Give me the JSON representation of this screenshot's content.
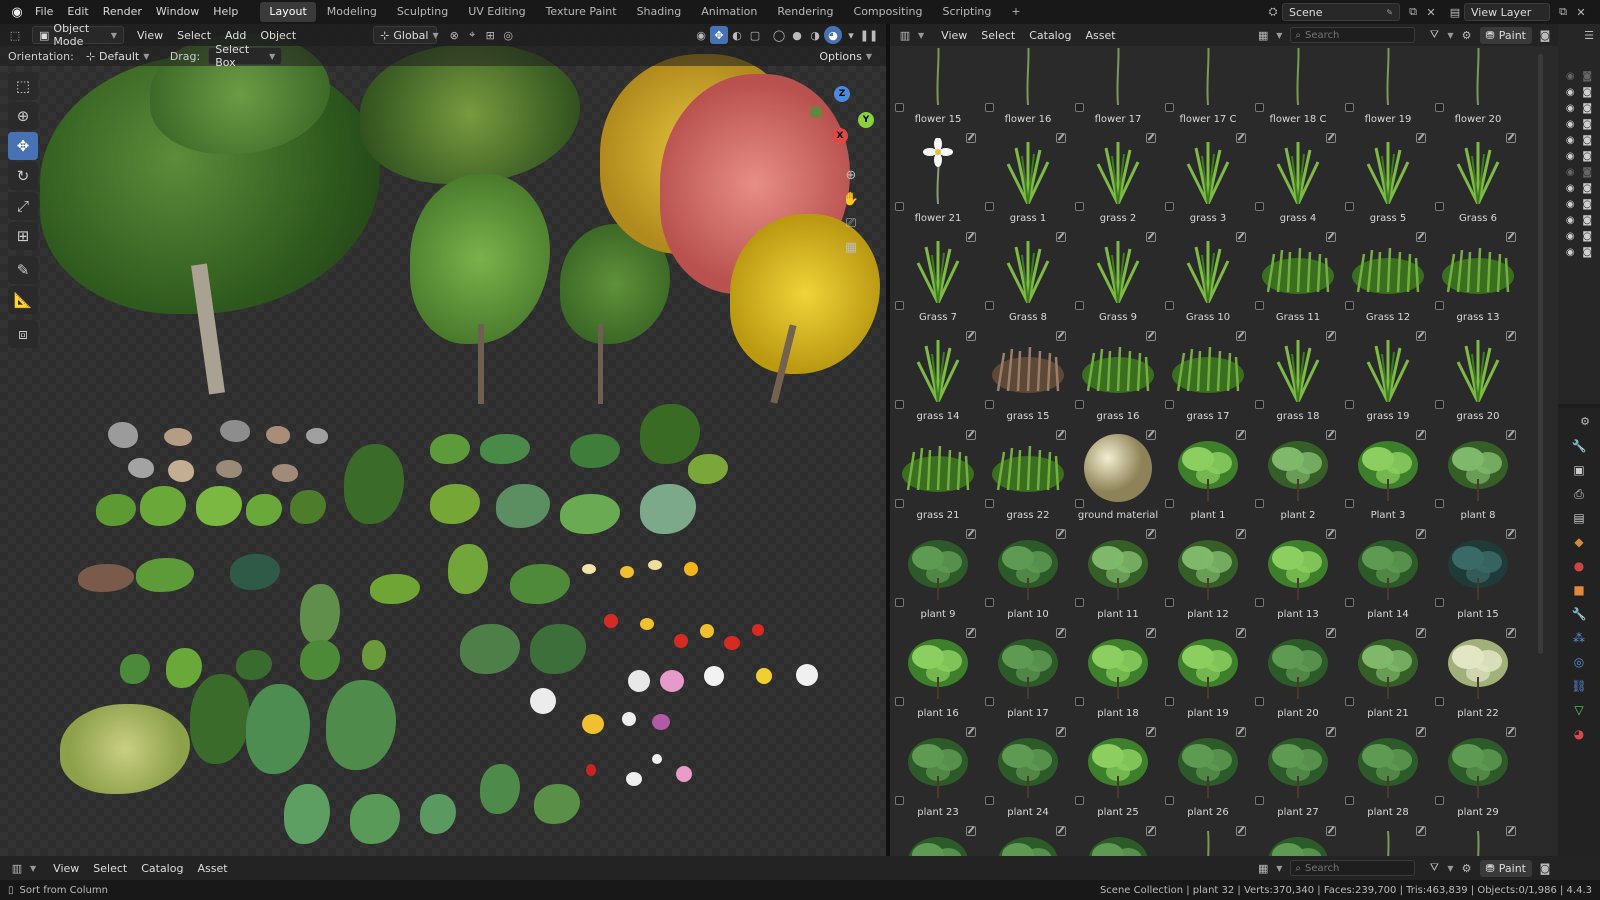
{
  "topbar": {
    "menus": [
      "File",
      "Edit",
      "Render",
      "Window",
      "Help"
    ],
    "workspaces": [
      "Layout",
      "Modeling",
      "Sculpting",
      "UV Editing",
      "Texture Paint",
      "Shading",
      "Animation",
      "Rendering",
      "Compositing",
      "Scripting"
    ],
    "active_workspace": "Layout",
    "add_tab": "+",
    "scene": "Scene",
    "view_layer": "View Layer"
  },
  "viewport": {
    "mode": "Object Mode",
    "menus": [
      "View",
      "Select",
      "Add",
      "Object"
    ],
    "transform": "Global",
    "orientation_label": "Orientation:",
    "orientation": "Default",
    "drag_label": "Drag:",
    "drag": "Select Box",
    "options": "Options",
    "gizmo": {
      "x": "X",
      "y": "Y",
      "z": "Z"
    }
  },
  "asset_browser": {
    "menus": [
      "View",
      "Select",
      "Catalog",
      "Asset"
    ],
    "search_placeholder": "Search",
    "paint": "Paint",
    "assets": [
      {
        "name": "flower 15",
        "kind": "stem"
      },
      {
        "name": "flower 16",
        "kind": "stem"
      },
      {
        "name": "flower 17",
        "kind": "stem"
      },
      {
        "name": "flower 17 C",
        "kind": "stem"
      },
      {
        "name": "flower 18 C",
        "kind": "stem"
      },
      {
        "name": "flower 19",
        "kind": "stem"
      },
      {
        "name": "flower 20",
        "kind": "stem"
      },
      {
        "name": "flower 21",
        "kind": "flower"
      },
      {
        "name": "grass 1",
        "kind": "grass"
      },
      {
        "name": "grass 2",
        "kind": "grass"
      },
      {
        "name": "grass 3",
        "kind": "grass"
      },
      {
        "name": "grass 4",
        "kind": "grass"
      },
      {
        "name": "grass 5",
        "kind": "grass"
      },
      {
        "name": "Grass 6",
        "kind": "grass"
      },
      {
        "name": "Grass 7",
        "kind": "grass"
      },
      {
        "name": "Grass 8",
        "kind": "grass"
      },
      {
        "name": "Grass 9",
        "kind": "grass"
      },
      {
        "name": "Grass 10",
        "kind": "grass"
      },
      {
        "name": "Grass 11",
        "kind": "tuft"
      },
      {
        "name": "Grass 12",
        "kind": "tuft"
      },
      {
        "name": "grass 13",
        "kind": "tuft"
      },
      {
        "name": "grass 14",
        "kind": "grass"
      },
      {
        "name": "grass 15",
        "kind": "dry"
      },
      {
        "name": "grass 16",
        "kind": "tuft"
      },
      {
        "name": "grass 17",
        "kind": "tuft"
      },
      {
        "name": "grass 18",
        "kind": "grass"
      },
      {
        "name": "grass 19",
        "kind": "grass"
      },
      {
        "name": "grass 20",
        "kind": "grass"
      },
      {
        "name": "grass 21",
        "kind": "tuft"
      },
      {
        "name": "grass 22",
        "kind": "tuft"
      },
      {
        "name": "ground material",
        "kind": "sphere"
      },
      {
        "name": "plant 1",
        "kind": "plant"
      },
      {
        "name": "plant 2",
        "kind": "fern"
      },
      {
        "name": "Plant 3",
        "kind": "plant"
      },
      {
        "name": "plant 8",
        "kind": "fern"
      },
      {
        "name": "plant 9",
        "kind": "bush"
      },
      {
        "name": "plant 10",
        "kind": "bush"
      },
      {
        "name": "plant 11",
        "kind": "fern"
      },
      {
        "name": "plant 12",
        "kind": "fern"
      },
      {
        "name": "plant 13",
        "kind": "plant"
      },
      {
        "name": "plant 14",
        "kind": "bush"
      },
      {
        "name": "plant 15",
        "kind": "dark"
      },
      {
        "name": "plant 16",
        "kind": "plant"
      },
      {
        "name": "plant 17",
        "kind": "bush"
      },
      {
        "name": "plant 18",
        "kind": "plant"
      },
      {
        "name": "plant 19",
        "kind": "plant"
      },
      {
        "name": "plant 20",
        "kind": "bush"
      },
      {
        "name": "plant 21",
        "kind": "fern"
      },
      {
        "name": "plant 22",
        "kind": "pale"
      },
      {
        "name": "plant 23",
        "kind": "bush"
      },
      {
        "name": "plant 24",
        "kind": "bush"
      },
      {
        "name": "plant 25",
        "kind": "plant"
      },
      {
        "name": "plant 26",
        "kind": "bush"
      },
      {
        "name": "plant 27",
        "kind": "bush"
      },
      {
        "name": "plant 28",
        "kind": "bush"
      },
      {
        "name": "plant 29",
        "kind": "bush"
      },
      {
        "name": "",
        "kind": "bush"
      },
      {
        "name": "",
        "kind": "bush"
      },
      {
        "name": "",
        "kind": "bush"
      },
      {
        "name": "",
        "kind": "stem"
      },
      {
        "name": "",
        "kind": "bush"
      },
      {
        "name": "",
        "kind": "stem"
      },
      {
        "name": "",
        "kind": "stem"
      }
    ]
  },
  "bottom_bar": {
    "menus": [
      "View",
      "Select",
      "Catalog",
      "Asset"
    ],
    "search_placeholder": "Search",
    "paint": "Paint"
  },
  "status": {
    "left": "Sort from Column",
    "right": "Scene Collection | plant 32 | Verts:370,340 | Faces:239,700 | Tris:463,839 | Objects:0/1,986 | 4.4.3"
  },
  "colors": {
    "accent": "#4772b3",
    "x_axis": "#e04848",
    "y_axis": "#8bd13b",
    "z_axis": "#4a8bdf"
  }
}
